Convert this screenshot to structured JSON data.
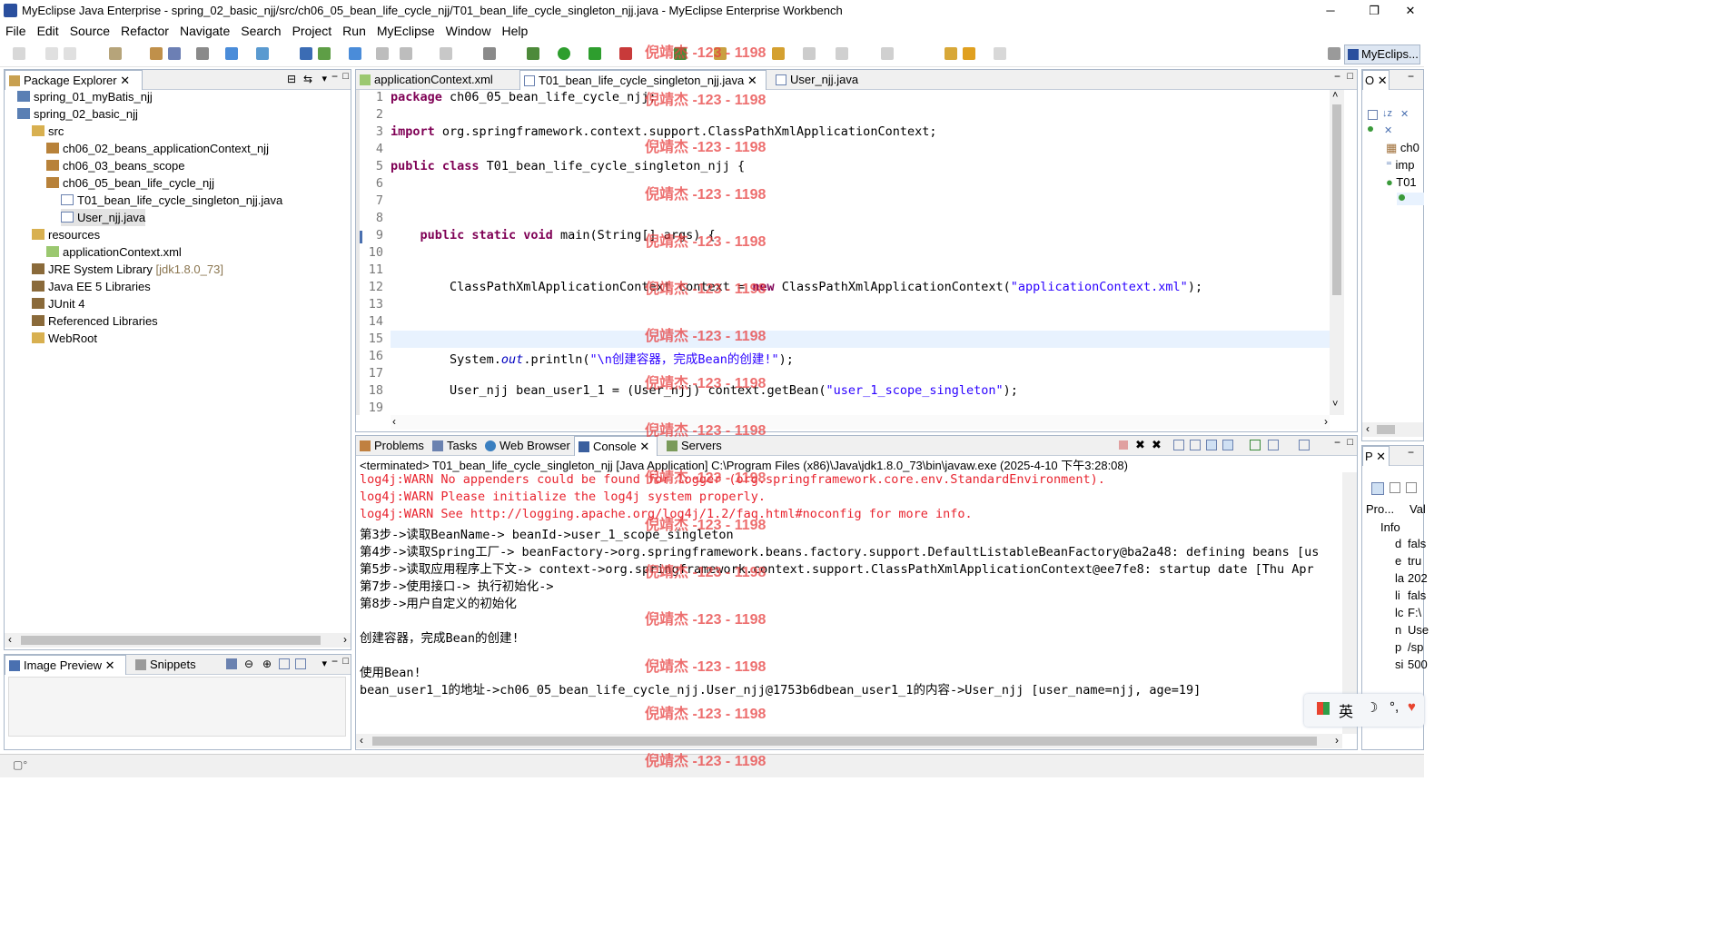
{
  "window": {
    "title": "MyEclipse Java Enterprise - spring_02_basic_njj/src/ch06_05_bean_life_cycle_njj/T01_bean_life_cycle_singleton_njj.java - MyEclipse Enterprise Workbench",
    "minimize": "─",
    "maximize": "❐",
    "close": "✕"
  },
  "menu": [
    "File",
    "Edit",
    "Source",
    "Refactor",
    "Navigate",
    "Search",
    "Project",
    "Run",
    "MyEclipse",
    "Window",
    "Help"
  ],
  "perspective": {
    "label": "MyEclips..."
  },
  "package_explorer": {
    "title": "Package Explorer",
    "items": [
      {
        "label": "spring_01_myBatis_njj",
        "indent": 1,
        "icon": "project-icon"
      },
      {
        "label": "spring_02_basic_njj",
        "indent": 1,
        "icon": "project-icon"
      },
      {
        "label": "src",
        "indent": 2,
        "icon": "folder-icon"
      },
      {
        "label": "ch06_02_beans_applicationContext_njj",
        "indent": 3,
        "icon": "package-icon"
      },
      {
        "label": "ch06_03_beans_scope",
        "indent": 3,
        "icon": "package-icon"
      },
      {
        "label": "ch06_05_bean_life_cycle_njj",
        "indent": 3,
        "icon": "package-icon"
      },
      {
        "label": "T01_bean_life_cycle_singleton_njj.java",
        "indent": 4,
        "icon": "java-file-icon"
      },
      {
        "label": "User_njj.java",
        "indent": 4,
        "icon": "java-file-icon"
      },
      {
        "label": "resources",
        "indent": 2,
        "icon": "folder-icon"
      },
      {
        "label": "applicationContext.xml",
        "indent": 3,
        "icon": "xml-file-icon"
      },
      {
        "label": "JRE System Library",
        "suffix": "[jdk1.8.0_73]",
        "indent": 2,
        "icon": "library-icon"
      },
      {
        "label": "Java EE 5 Libraries",
        "indent": 2,
        "icon": "library-icon"
      },
      {
        "label": "JUnit 4",
        "indent": 2,
        "icon": "library-icon"
      },
      {
        "label": "Referenced Libraries",
        "indent": 2,
        "icon": "library-icon"
      },
      {
        "label": "WebRoot",
        "indent": 2,
        "icon": "folder-icon"
      }
    ]
  },
  "image_preview": {
    "title": "Image Preview",
    "snippets": "Snippets"
  },
  "editor": {
    "tabs": [
      {
        "label": "applicationContext.xml",
        "active": false
      },
      {
        "label": "T01_bean_life_cycle_singleton_njj.java",
        "active": true
      },
      {
        "label": "User_njj.java",
        "active": false
      }
    ],
    "lines": [
      {
        "n": "1",
        "k": "package",
        "t": " ch06_05_bean_life_cycle_njj;"
      },
      {
        "n": "2",
        "k": "",
        "t": ""
      },
      {
        "n": "3",
        "k": "import",
        "t": " org.springframework.context.support.ClassPathXmlApplicationContext;"
      },
      {
        "n": "4",
        "k": "",
        "t": ""
      },
      {
        "n": "5",
        "k": "public class",
        "t": " T01_bean_life_cycle_singleton_njj {"
      },
      {
        "n": "6",
        "k": "",
        "t": ""
      },
      {
        "n": "7",
        "k": "",
        "t": ""
      },
      {
        "n": "8",
        "k": "",
        "t": ""
      },
      {
        "n": "9",
        "k": "    public static void",
        "t": " main(String[] args) {"
      },
      {
        "n": "10",
        "k": "",
        "t": ""
      },
      {
        "n": "11",
        "k": "",
        "t": ""
      },
      {
        "n": "12",
        "k": "",
        "t": "        ClassPathXmlApplicationContext context = ",
        "k2": "new",
        "t2": " ClassPathXmlApplicationContext(",
        "s": "\"applicationContext.xml\"",
        "t3": ");"
      },
      {
        "n": "13",
        "k": "",
        "t": ""
      },
      {
        "n": "14",
        "k": "",
        "t": ""
      },
      {
        "n": "15",
        "k": "",
        "t": ""
      },
      {
        "n": "16",
        "k": "",
        "t": "        System.",
        "i": "out",
        "t2": ".println(",
        "s": "\"\\n创建容器，完成Bean的创建!\"",
        "t3": ");"
      },
      {
        "n": "17",
        "k": "",
        "t": ""
      },
      {
        "n": "18",
        "k": "",
        "t": "        User_njj bean_user1_1 = (User_njj) context.getBean(",
        "s": "\"user_1_scope_singleton\"",
        "t3": ");"
      },
      {
        "n": "19",
        "k": "",
        "t": ""
      }
    ]
  },
  "bottom_tabs": [
    "Problems",
    "Tasks",
    "Web Browser",
    "Console",
    "Servers"
  ],
  "console": {
    "header": "<terminated> T01_bean_life_cycle_singleton_njj [Java Application] C:\\Program Files (x86)\\Java\\jdk1.8.0_73\\bin\\javaw.exe (2025-4-10 下午3:28:08)",
    "lines": [
      {
        "text": "log4j:WARN No appenders could be found for logger (org.springframework.core.env.StandardEnvironment).",
        "color": "red"
      },
      {
        "text": "log4j:WARN Please initialize the log4j system properly.",
        "color": "red"
      },
      {
        "text": "log4j:WARN See http://logging.apache.org/log4j/1.2/faq.html#noconfig for more info.",
        "color": "red"
      },
      {
        "text": "第3步->读取BeanName-> beanId->user_1_scope_singleton",
        "color": "black"
      },
      {
        "text": "第4步->读取Spring工厂-> beanFactory->org.springframework.beans.factory.support.DefaultListableBeanFactory@ba2a48: defining beans [us",
        "color": "black"
      },
      {
        "text": "第5步->读取应用程序上下文-> context->org.springframework.context.support.ClassPathXmlApplicationContext@ee7fe8: startup date [Thu Apr",
        "color": "black"
      },
      {
        "text": "第7步->使用接口-> 执行初始化->",
        "color": "black"
      },
      {
        "text": "第8步->用户自定义的初始化",
        "color": "black"
      },
      {
        "text": "",
        "color": "black"
      },
      {
        "text": "创建容器，完成Bean的创建!",
        "color": "black"
      },
      {
        "text": "",
        "color": "black"
      },
      {
        "text": "使用Bean!",
        "color": "black"
      },
      {
        "text": "bean_user1_1的地址->ch06_05_bean_life_cycle_njj.User_njj@1753b6dbean_user1_1的内容->User_njj [user_name=njj, age=19]",
        "color": "black"
      }
    ]
  },
  "outline": {
    "tab": "O",
    "items": [
      "ch0",
      "imp",
      "T01"
    ]
  },
  "properties": {
    "tab": "P",
    "col1": "Pro...",
    "col2": "Val",
    "info": "Info",
    "rows": [
      {
        "k": "d",
        "v": "fals"
      },
      {
        "k": "e",
        "v": "tru"
      },
      {
        "k": "la",
        "v": "202"
      },
      {
        "k": "li",
        "v": "fals"
      },
      {
        "k": "lc",
        "v": "F:\\"
      },
      {
        "k": "n",
        "v": "Use"
      },
      {
        "k": "p",
        "v": "/sp"
      },
      {
        "k": "si",
        "v": "500"
      }
    ]
  },
  "ime": {
    "label": "英"
  },
  "watermark": "倪靖杰 -123 - 1198"
}
